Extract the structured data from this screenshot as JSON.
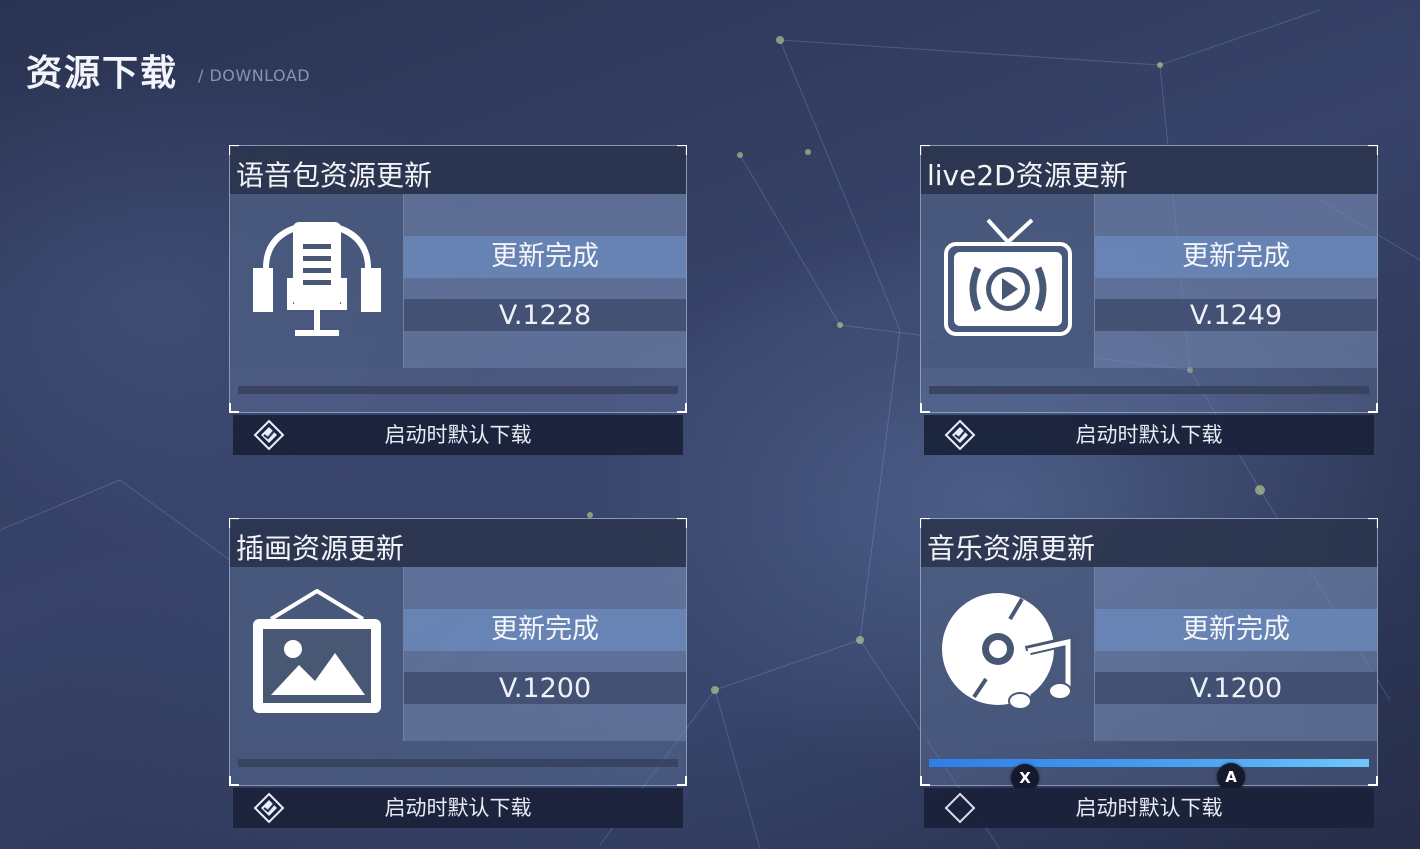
{
  "header": {
    "title": "资源下载",
    "subtitle": "/ DOWNLOAD"
  },
  "cards": [
    {
      "title": "语音包资源更新",
      "icon": "microphone-headphones-icon",
      "status": "更新完成",
      "version": "V.1228",
      "progress": 0,
      "auto_download_label": "启动时默认下载",
      "auto_download_checked": true
    },
    {
      "title": "live2D资源更新",
      "icon": "tv-play-icon",
      "status": "更新完成",
      "version": "V.1249",
      "progress": 0,
      "auto_download_label": "启动时默认下载",
      "auto_download_checked": true
    },
    {
      "title": "插画资源更新",
      "icon": "picture-frame-icon",
      "status": "更新完成",
      "version": "V.1200",
      "progress": 0,
      "auto_download_label": "启动时默认下载",
      "auto_download_checked": true
    },
    {
      "title": "音乐资源更新",
      "icon": "music-disc-icon",
      "status": "更新完成",
      "version": "V.1200",
      "progress": 1,
      "auto_download_label": "启动时默认下载",
      "auto_download_checked": false
    }
  ],
  "button_hints": {
    "x": "X",
    "a": "A"
  },
  "colors": {
    "accent": "#49a3f2",
    "panel": "#485874",
    "footer": "#1a223a"
  }
}
